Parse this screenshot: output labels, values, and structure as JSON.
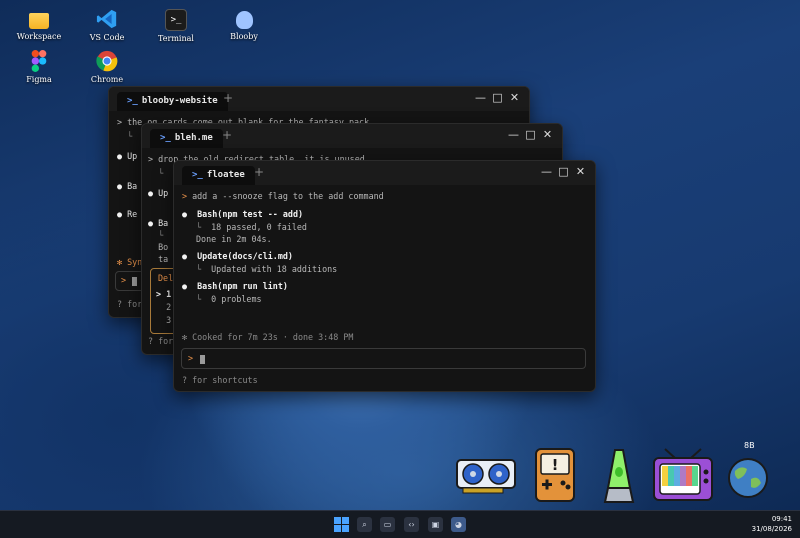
{
  "desktop_icons": [
    {
      "label": "Workspace",
      "icon": "folder-icon"
    },
    {
      "label": "VS Code",
      "icon": "vscode-icon"
    },
    {
      "label": "Terminal",
      "icon": "terminal-icon"
    },
    {
      "label": "Blooby",
      "icon": "blooby-icon"
    },
    {
      "label": "Figma",
      "icon": "figma-icon"
    },
    {
      "label": "Chrome",
      "icon": "chrome-icon"
    }
  ],
  "window_back": {
    "tab_prompt": ">_",
    "tab_title": "blooby-website",
    "lines": [
      "> the og cards come out blank for the fantasy pack",
      "  └ ",
      "● Up",
      "● Ba",
      "● Re"
    ],
    "status_fragment": "✻ Syn",
    "input_prompt": ">",
    "hint": "? for"
  },
  "window_mid": {
    "tab_prompt": ">_",
    "tab_title": "bleh.me",
    "lines": [
      "> drop the old redirect table, it is unused",
      "  └",
      "● Up",
      "● Ba",
      "  └",
      "  Bo",
      "  ta"
    ],
    "panel_lines": [
      "Del",
      "> 1",
      "  2",
      "  3"
    ],
    "hint": "? for"
  },
  "window_front": {
    "tab_prompt": ">_",
    "tab_title": "floatee",
    "plus": "+",
    "controls": {
      "minimize": "—",
      "maximize": "□",
      "close": "✕"
    },
    "prompt_line": "add a --snooze flag to the add command",
    "steps": [
      {
        "title": "Bash(npm test -- add)",
        "details": [
          "18 passed, 0 failed",
          "Done in 2m 04s."
        ]
      },
      {
        "title": "Update(docs/cli.md)",
        "details": [
          "Updated with 18 additions"
        ]
      },
      {
        "title": "Bash(npm run lint)",
        "details": [
          "0 problems"
        ]
      }
    ],
    "status": "✻ Cooked for 7m 23s · done 3:48 PM",
    "input_prompt": ">",
    "hint": "? for shortcuts"
  },
  "taskbar": {
    "time": "09:41",
    "date": "31/08/2026"
  },
  "widget_label": "8B"
}
